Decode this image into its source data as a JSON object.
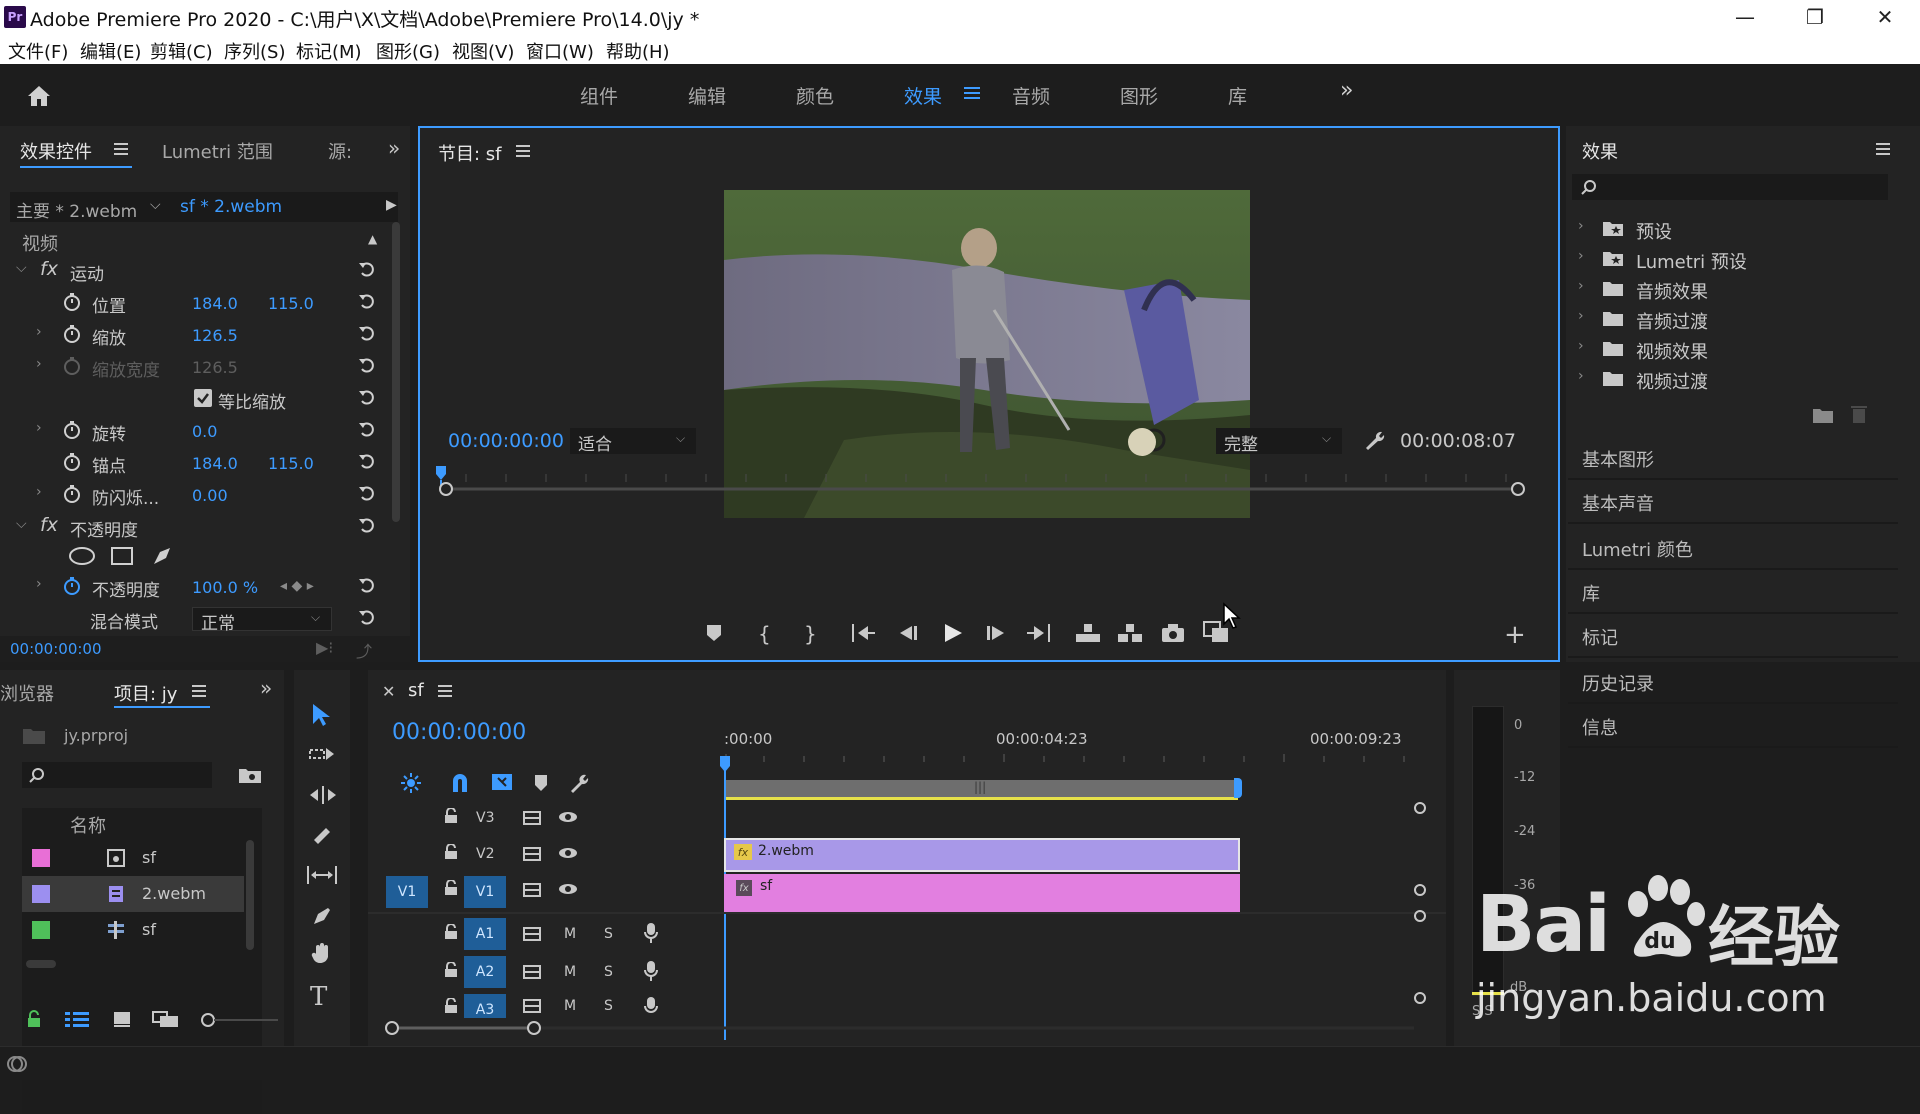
{
  "app": {
    "title": "Adobe Premiere Pro 2020 - C:\\用户\\X\\文档\\Adobe\\Premiere Pro\\14.0\\jy *",
    "icon_text": "Pr",
    "window_controls": {
      "minimize": "—",
      "restore": "❐",
      "close": "✕"
    }
  },
  "menu": [
    "文件(F)",
    "编辑(E)",
    "剪辑(C)",
    "序列(S)",
    "标记(M)",
    "图形(G)",
    "视图(V)",
    "窗口(W)",
    "帮助(H)"
  ],
  "workspaces": {
    "items": [
      "组件",
      "编辑",
      "颜色",
      "效果",
      "音频",
      "图形",
      "库"
    ],
    "active": "效果",
    "more": "»"
  },
  "effect_controls": {
    "tabs": [
      "效果控件",
      "Lumetri 范围",
      "源:"
    ],
    "master_label": "主要 * 2.webm",
    "sequence_label": "sf * 2.webm",
    "section": "视频",
    "motion": {
      "label": "运动",
      "position": {
        "label": "位置",
        "x": "184.0",
        "y": "115.0"
      },
      "scale": {
        "label": "缩放",
        "value": "126.5"
      },
      "scale_width": {
        "label": "缩放宽度",
        "value": "126.5"
      },
      "uniform_scale": {
        "label": "等比缩放",
        "checked": true
      },
      "rotation": {
        "label": "旋转",
        "value": "0.0"
      },
      "anchor": {
        "label": "锚点",
        "x": "184.0",
        "y": "115.0"
      },
      "anti_flicker": {
        "label": "防闪烁...",
        "value": "0.00"
      }
    },
    "opacity": {
      "label": "不透明度",
      "opacity_label": "不透明度",
      "opacity_value": "100.0 %",
      "blend_label": "混合模式",
      "blend_value": "正常"
    },
    "timecode": "00:00:00:00"
  },
  "program_monitor": {
    "tab": "节目: sf",
    "timecode": "00:00:00:00",
    "fit": "适合",
    "quality": "完整",
    "duration": "00:00:08:07"
  },
  "effects_panel": {
    "title": "效果",
    "items": [
      "预设",
      "Lumetri 预设",
      "音频效果",
      "音频过渡",
      "视频效果",
      "视频过渡"
    ],
    "collapsed_panels": [
      "基本图形",
      "基本声音",
      "Lumetri 颜色",
      "库",
      "标记",
      "历史记录",
      "信息"
    ]
  },
  "project": {
    "tabs": [
      "浏览器",
      "项目: jy"
    ],
    "file": "jy.prproj",
    "column_name": "名称",
    "items": [
      {
        "name": "sf",
        "color": "#e86fd6"
      },
      {
        "name": "2.webm",
        "color": "#9c8ff0"
      },
      {
        "name": "sf",
        "color": "#4fc05a"
      }
    ]
  },
  "timeline": {
    "tab": "sf",
    "timecode": "00:00:00:00",
    "ruler": ":00:00",
    "ruler_mid": "00:00:04:23",
    "ruler_end": "00:00:09:23",
    "marker_glyph": "|||",
    "video_tracks": [
      "V3",
      "V2",
      "V1"
    ],
    "audio_tracks": [
      "A1",
      "A2",
      "A3"
    ],
    "source_patch": "V1",
    "m_label": "M",
    "s_label": "S",
    "clips": {
      "v2": {
        "label": "2.webm",
        "fx": "fx",
        "color": "#a898e8"
      },
      "v1": {
        "label": "sf",
        "fx": "fx",
        "color": "#e27fe0"
      }
    }
  },
  "audio_meter": {
    "ticks": [
      "0",
      "-12",
      "-24",
      "-36"
    ],
    "unit": "dB",
    "s_labels": "S  S"
  },
  "watermark": {
    "line1": "Bai",
    "line2": "经验",
    "url": "jingyan.baidu.com"
  },
  "colors": {
    "accent": "#3d9bff",
    "panel_bg": "#232323",
    "app_bg": "#1d1d1d",
    "track_blue": "#1f5e98"
  }
}
